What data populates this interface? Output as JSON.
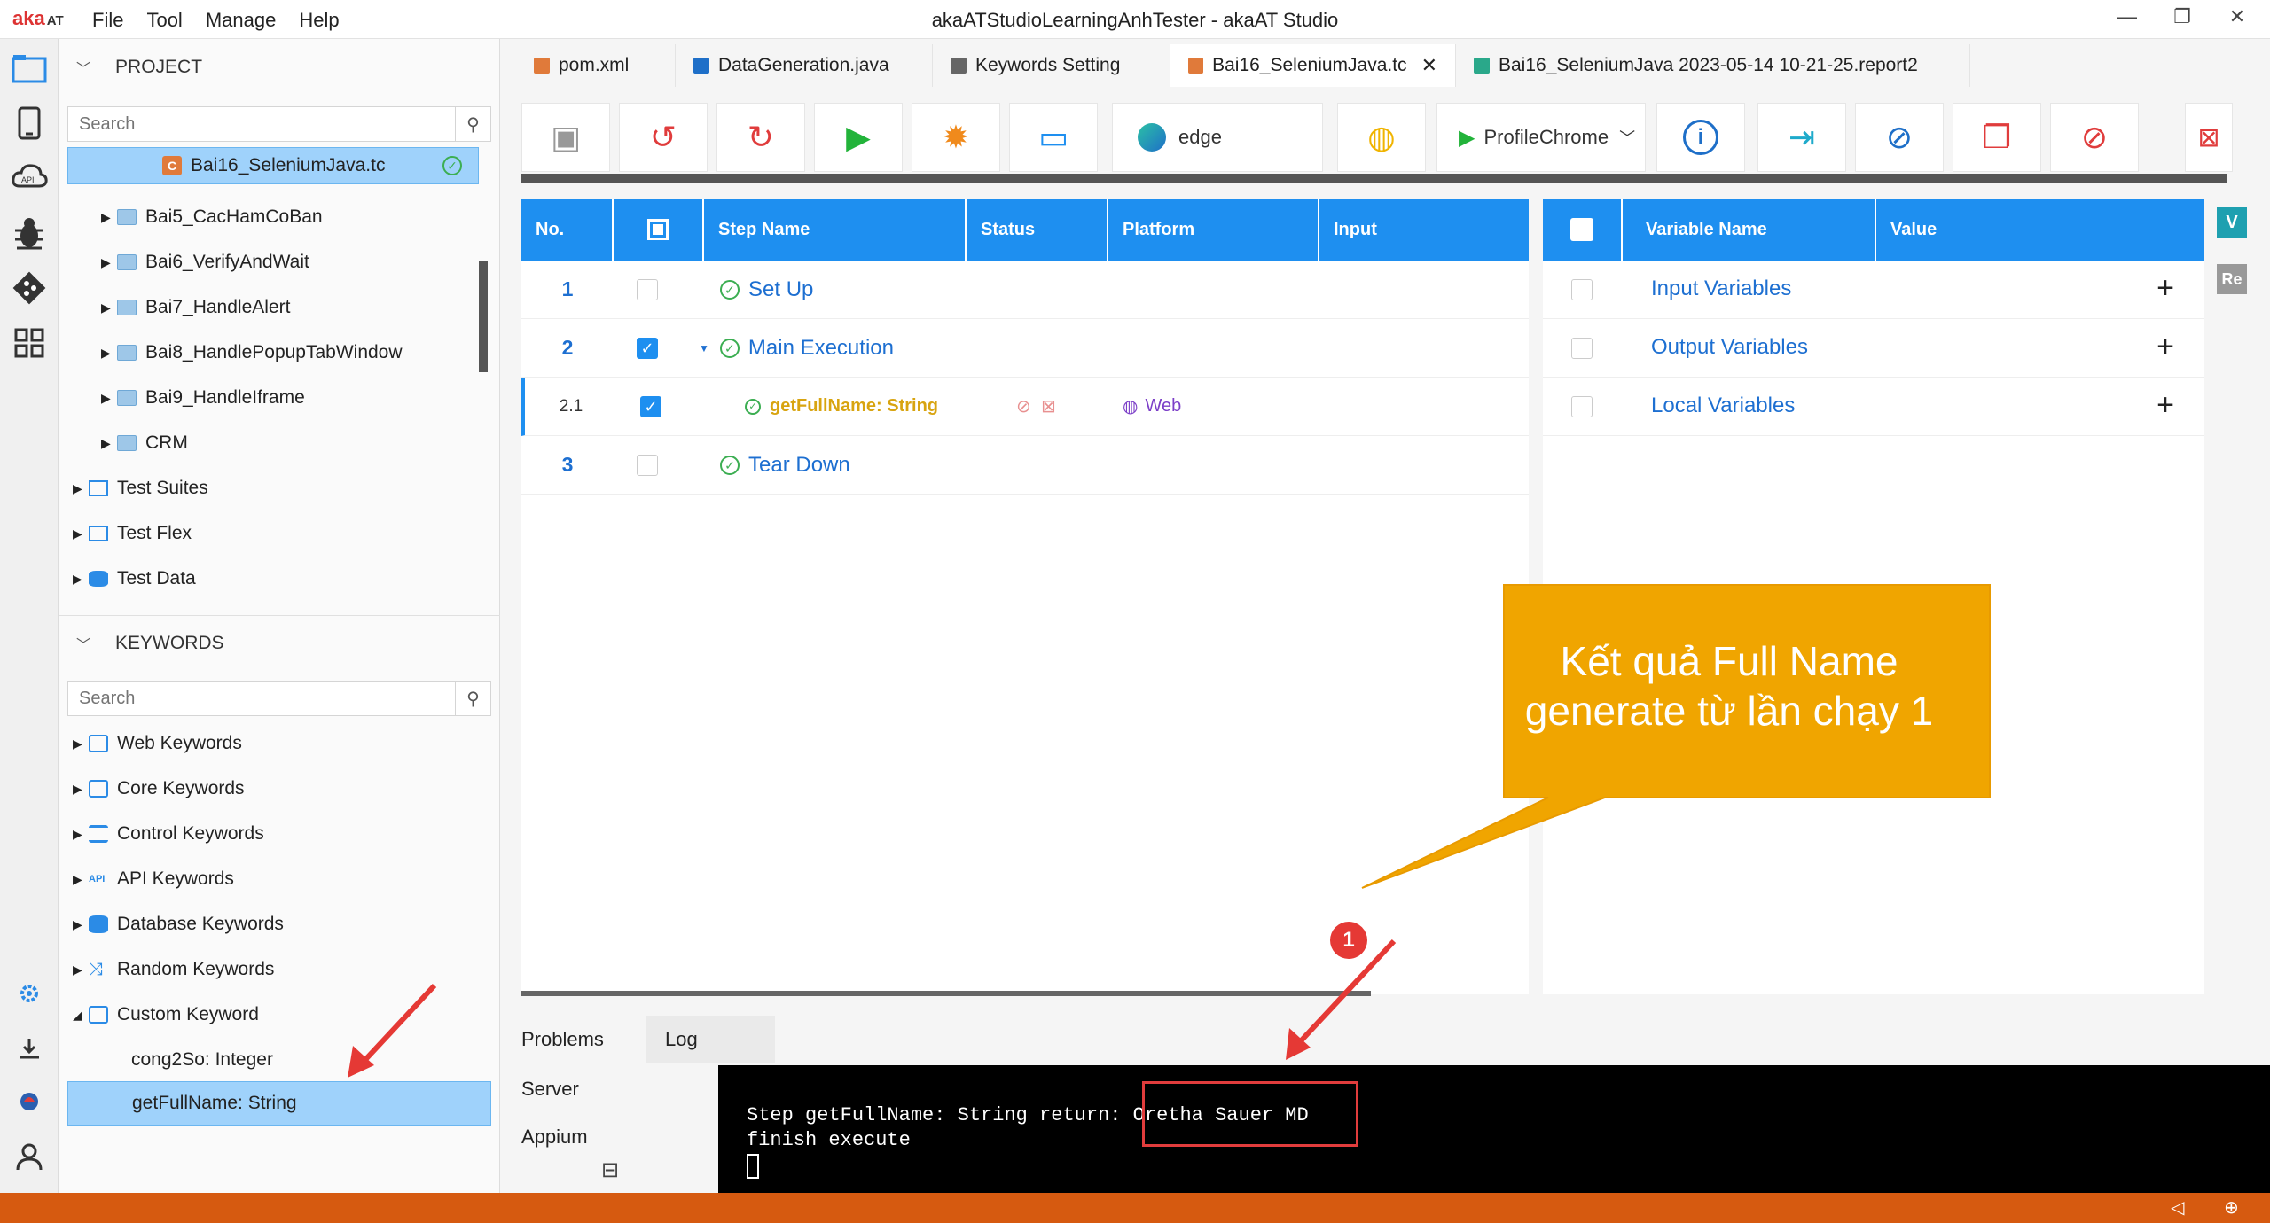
{
  "app": {
    "logo": "aka",
    "logo_suffix": "AT",
    "title": "akaATStudioLearningAnhTester - akaAT Studio",
    "menu": [
      "File",
      "Tool",
      "Manage",
      "Help"
    ],
    "window_buttons": [
      "—",
      "❐",
      "✕"
    ]
  },
  "project": {
    "header": "PROJECT",
    "search_placeholder": "Search",
    "selected_item": "Bai16_SeleniumJava.tc",
    "items": [
      "Bai5_CacHamCoBan",
      "Bai6_VerifyAndWait",
      "Bai7_HandleAlert",
      "Bai8_HandlePopupTabWindow",
      "Bai9_HandleIframe",
      "CRM"
    ],
    "roots": [
      "Test Suites",
      "Test Flex",
      "Test Data"
    ]
  },
  "keywords": {
    "header": "KEYWORDS",
    "search_placeholder": "Search",
    "groups": [
      "Web Keywords",
      "Core Keywords",
      "Control Keywords",
      "API Keywords",
      "Database Keywords",
      "Random Keywords",
      "Custom Keyword"
    ],
    "custom_children": [
      "cong2So: Integer",
      "getFullName: String"
    ]
  },
  "tabs": [
    {
      "label": "pom.xml",
      "color": "#e07a3a"
    },
    {
      "label": "DataGeneration.java",
      "color": "#1e6fc8"
    },
    {
      "label": "Keywords Setting",
      "color": "#666666"
    },
    {
      "label": "Bai16_SeleniumJava.tc",
      "color": "#e07a3a",
      "active": true,
      "close": "✕"
    },
    {
      "label": "Bai16_SeleniumJava 2023-05-14 10-21-25.report2",
      "color": "#2aa88a"
    }
  ],
  "toolbar": {
    "browser": "edge",
    "profile": "ProfileChrome"
  },
  "steps": {
    "headers": [
      "No.",
      "Step Name",
      "Status",
      "Platform",
      "Input"
    ],
    "rows": [
      {
        "no": "1",
        "name": "Set Up",
        "checked": false
      },
      {
        "no": "2",
        "name": "Main Execution",
        "checked": true
      },
      {
        "no": "2.1",
        "name": "getFullName: String",
        "checked": true,
        "platform": "Web"
      },
      {
        "no": "3",
        "name": "Tear Down",
        "checked": false
      }
    ]
  },
  "variables": {
    "headers": [
      "Variable Name",
      "Value"
    ],
    "rows": [
      "Input Variables",
      "Output Variables",
      "Local Variables"
    ],
    "plus": "+"
  },
  "right_badges": [
    "V",
    "Re"
  ],
  "bottom": {
    "tabs": [
      "Problems",
      "Log"
    ],
    "side": [
      "Server",
      "Appium"
    ],
    "console": [
      "Step getFullName: String return: Oretha Sauer MD",
      "finish execute"
    ]
  },
  "callout": {
    "text": "Kết quả Full Name generate từ lần chạy 1",
    "marker": "1"
  },
  "colors": {
    "accent": "#1e8ff0",
    "statusbar": "#d65a10",
    "callout": "#f0a500",
    "arrow": "#e53935"
  }
}
